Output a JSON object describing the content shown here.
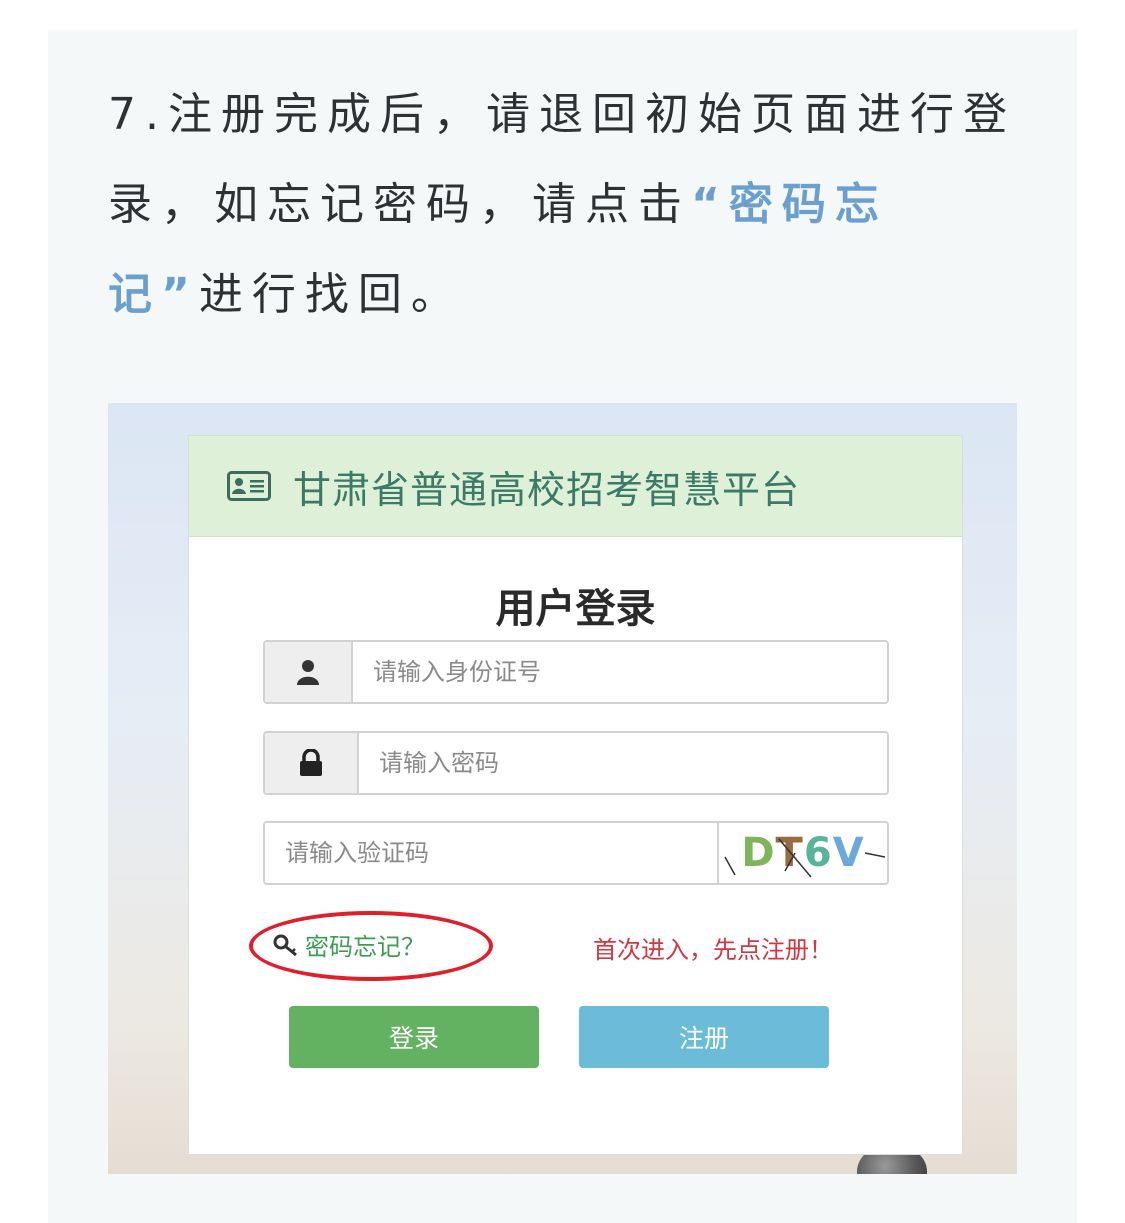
{
  "instruction": {
    "part1": "7.注册完成后，请退回初始页面进行登录，如忘记密码，请点击",
    "highlight": "“密码忘记”",
    "part2": "进行找回。"
  },
  "screenshot": {
    "header_icon": "id-card-icon",
    "platform_title": "甘肃省普通高校招考智慧平台",
    "login_title": "用户登录",
    "id_field": {
      "icon": "user-icon",
      "placeholder": "请输入身份证号",
      "value": ""
    },
    "password_field": {
      "icon": "lock-icon",
      "placeholder": "请输入密码",
      "value": ""
    },
    "captcha_field": {
      "placeholder": "请输入验证码",
      "value": ""
    },
    "captcha_image_text": "DT6V",
    "forgot_icon": "key-icon",
    "forgot_password": "密码忘记？",
    "first_time_hint": "首次进入，先点注册！",
    "login_button": "登录",
    "register_button": "注册",
    "colors": {
      "header_bg": "#dff0d8",
      "login_button": "#62b262",
      "register_button": "#6cbbd9",
      "forgot_link": "#3f9a55",
      "hint_text": "#d3363f",
      "annotation_oval": "#e01f2c",
      "instruction_highlight": "#6b9fce"
    }
  }
}
